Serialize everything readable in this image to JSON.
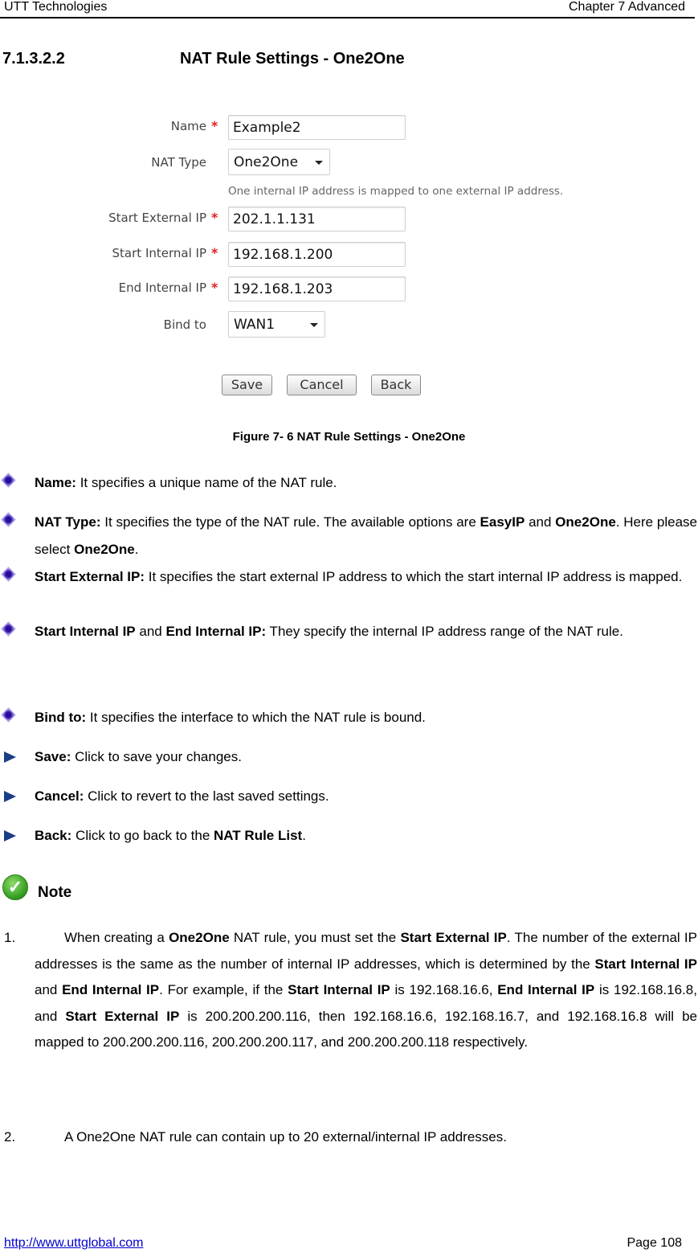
{
  "header": {
    "left": "UTT Technologies",
    "right": "Chapter 7 Advanced"
  },
  "section": {
    "number": "7.1.3.2.2",
    "title": "NAT Rule Settings - One2One"
  },
  "figure": {
    "fields": {
      "name": {
        "label": "Name",
        "required": "*",
        "value": "Example2"
      },
      "nat_type": {
        "label": "NAT Type",
        "value": "One2One",
        "hint": "One internal IP address is mapped to one external IP address."
      },
      "start_external_ip": {
        "label": "Start External IP",
        "required": "*",
        "value": "202.1.1.131"
      },
      "start_internal_ip": {
        "label": "Start Internal IP",
        "required": "*",
        "value": "192.168.1.200"
      },
      "end_internal_ip": {
        "label": "End Internal IP",
        "required": "*",
        "value": "192.168.1.203"
      },
      "bind_to": {
        "label": "Bind to",
        "value": "WAN1"
      }
    },
    "buttons": {
      "save": "Save",
      "cancel": "Cancel",
      "back": "Back"
    },
    "caption": "Figure 7- 6 NAT Rule Settings - One2One"
  },
  "bullets": [
    {
      "term": "Name:",
      "text": " It specifies a unique name of the NAT rule."
    },
    {
      "term": "NAT Type:",
      "text1": " It specifies the type of the NAT rule. The available options are ",
      "b1": "EasyIP",
      "text2": " and ",
      "b2": "One2One",
      "text3": ". Here please select ",
      "b3": "One2One",
      "text4": "."
    },
    {
      "term": "Start External IP:",
      "text": " It specifies the start external IP address to which the start internal IP address is mapped."
    },
    {
      "term1": "Start Internal IP",
      "and": " and ",
      "term2": "End Internal IP:",
      "text": " They specify the internal IP address range of the NAT rule."
    },
    {
      "term": "Bind to:",
      "text": " It specifies the interface to which the NAT rule is bound."
    }
  ],
  "actions": [
    {
      "term": "Save:",
      "text": " Click to save your changes."
    },
    {
      "term": "Cancel:",
      "text": " Click to revert to the last saved settings."
    },
    {
      "term": "Back:",
      "text": " Click to go back to the ",
      "b": "NAT Rule List",
      "end": "."
    }
  ],
  "note": {
    "label": "Note",
    "items": [
      {
        "num": "1.",
        "t1": "When creating a ",
        "b1": "One2One",
        "t2": " NAT rule, you must set the ",
        "b2": "Start External IP",
        "t3": ". The number of the external IP addresses is the same as the number of internal IP addresses, which is determined by the ",
        "b3": "Start Internal IP",
        "t4": " and ",
        "b4": "End Internal IP",
        "t5": ". For example, if the ",
        "b5": "Start Internal IP",
        "t6": " is 192.168.16.6, ",
        "b6": "End Internal IP",
        "t7": " is 192.168.16.8, and ",
        "b7": "Start External IP",
        "t8": " is 200.200.200.116, then 192.168.16.6, 192.168.16.7, and 192.168.16.8 will be mapped to 200.200.200.116, 200.200.200.117, and 200.200.200.118 respectively."
      },
      {
        "num": "2.",
        "text": "A One2One NAT rule can contain up to 20 external/internal IP addresses."
      }
    ]
  },
  "footer": {
    "link": "http://www.uttglobal.com",
    "page": "Page 108"
  }
}
